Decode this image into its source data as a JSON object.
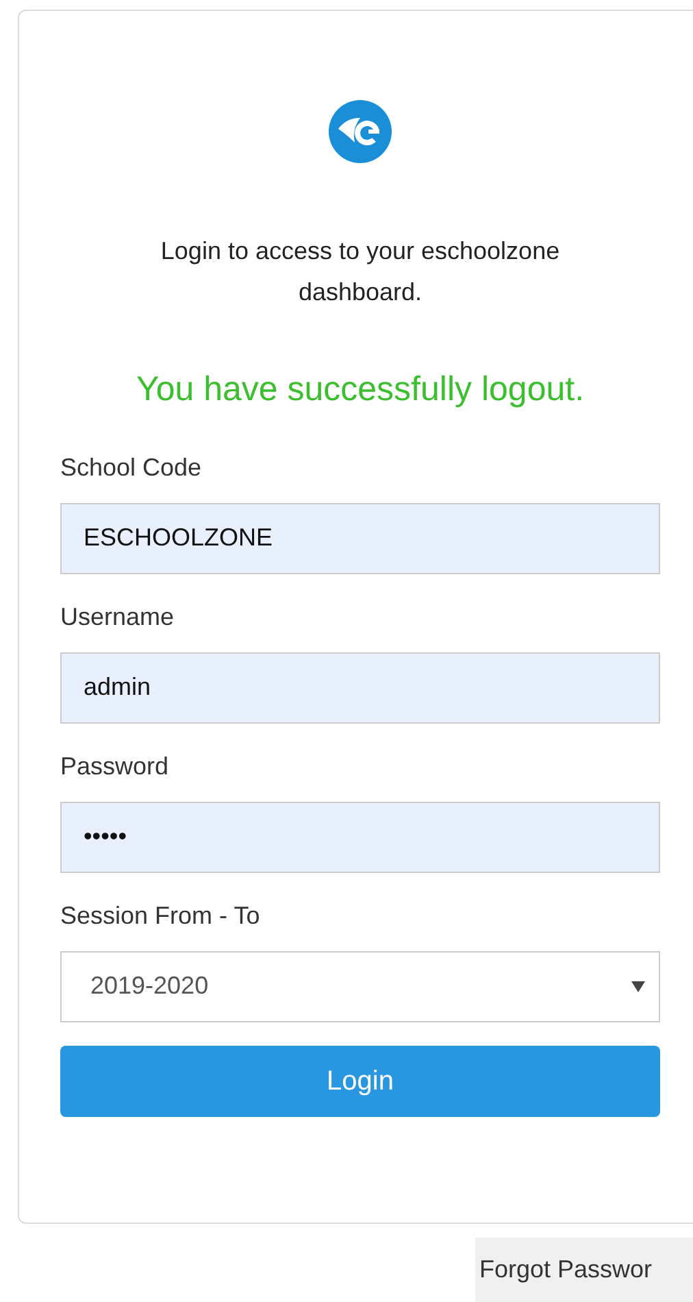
{
  "intro": "Login to access to your eschoolzone dashboard.",
  "message": "You have successfully logout.",
  "fields": [
    {
      "kind": "text",
      "label": "School Code",
      "value": "ESCHOOLZONE"
    },
    {
      "kind": "text",
      "label": "Username",
      "value": "admin"
    },
    {
      "kind": "text",
      "label": "Password",
      "value": "•••••"
    },
    {
      "kind": "select",
      "label": "Session From - To",
      "value": "2019-2020"
    }
  ],
  "login_button": "Login",
  "forgot_link": "Forgot Passwor"
}
